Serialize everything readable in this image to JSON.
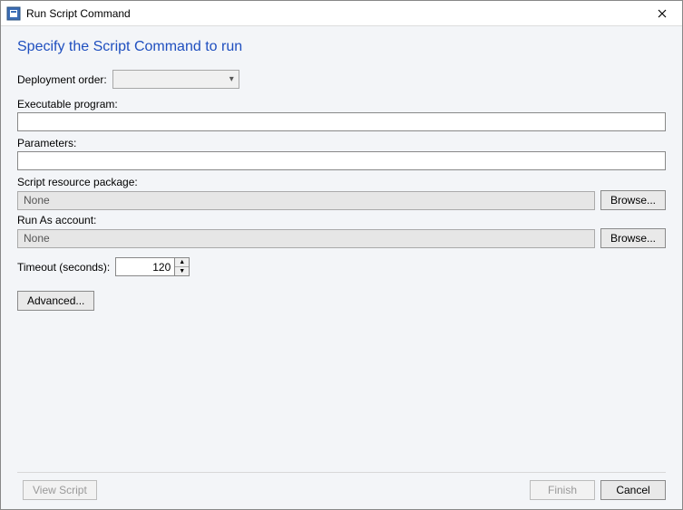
{
  "window": {
    "title": "Run Script Command"
  },
  "heading": "Specify the Script Command to run",
  "labels": {
    "deployment_order": "Deployment order:",
    "executable_program": "Executable program:",
    "parameters": "Parameters:",
    "script_resource_package": "Script resource package:",
    "run_as_account": "Run As account:",
    "timeout": "Timeout (seconds):"
  },
  "fields": {
    "deployment_order_value": "",
    "executable_program_value": "",
    "parameters_value": "",
    "script_resource_package_value": "None",
    "run_as_account_value": "None",
    "timeout_value": "120"
  },
  "buttons": {
    "browse": "Browse...",
    "advanced": "Advanced...",
    "view_script": "View Script",
    "finish": "Finish",
    "cancel": "Cancel"
  }
}
